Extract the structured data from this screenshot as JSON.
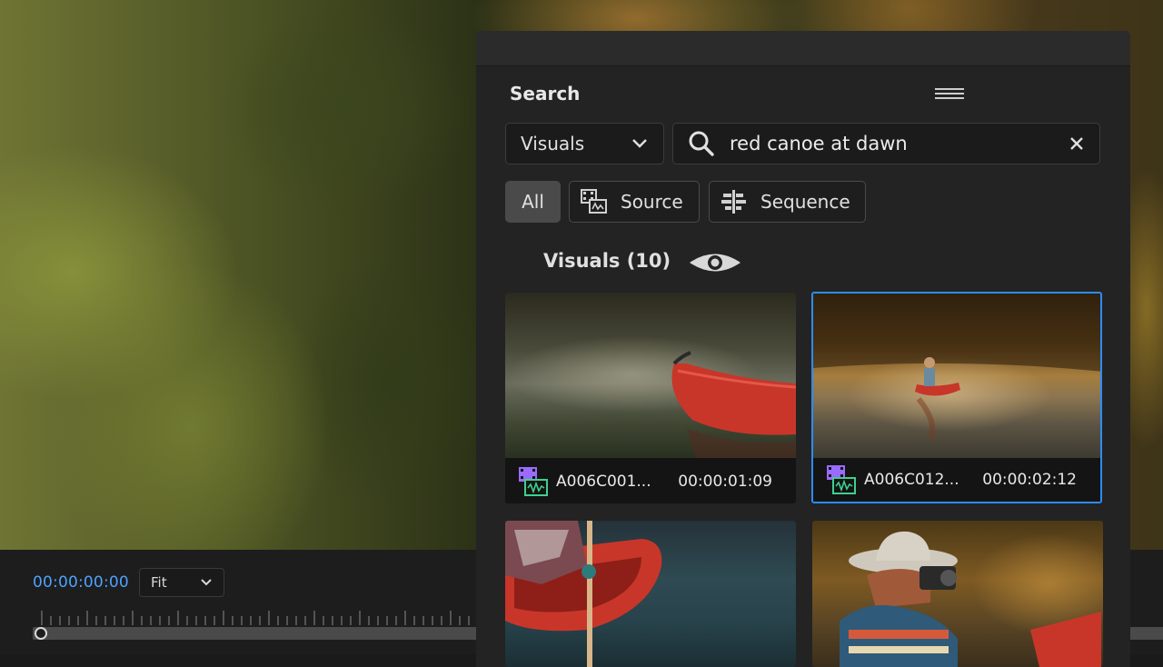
{
  "program_monitor": {
    "timecode": "00:00:00:00",
    "zoom": "Fit"
  },
  "search_panel": {
    "title": "Search",
    "scope": "Visuals",
    "query": "red canoe at dawn",
    "filters": {
      "all": "All",
      "source": "Source",
      "sequence": "Sequence"
    },
    "section_title": "Visuals (10)",
    "results": [
      {
        "name": "A006C001...",
        "duration": "00:00:01:09",
        "selected": false
      },
      {
        "name": "A006C012...",
        "duration": "00:00:02:12",
        "selected": true
      },
      {
        "name": "",
        "duration": "",
        "selected": false
      },
      {
        "name": "",
        "duration": "",
        "selected": false
      }
    ]
  },
  "colors": {
    "accent": "#2c8cff",
    "timecode": "#4da3ff",
    "clip_video_icon": "#9b6bff",
    "clip_audio_icon": "#3fcf8e",
    "canoe": "#c8362a"
  },
  "icons": {
    "menu": "hamburger-icon",
    "search": "search-icon",
    "clear": "close-icon",
    "dropdown": "chevron-down-icon",
    "source": "source-clip-icon",
    "sequence": "sequence-icon",
    "preview": "eye-icon",
    "clip": "video-audio-clip-icon"
  }
}
